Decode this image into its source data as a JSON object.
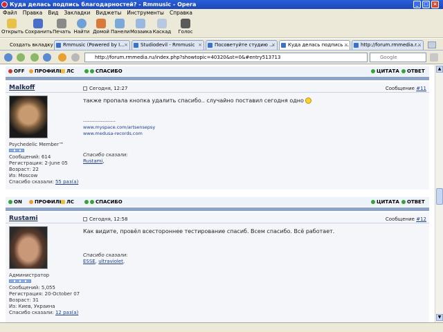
{
  "window": {
    "title": "Куда делась подпись благодарностей? - Rmmusic - Opera"
  },
  "menu": [
    "Файл",
    "Правка",
    "Вид",
    "Закладки",
    "Виджеты",
    "Инструменты",
    "Справка"
  ],
  "toolbar": {
    "buttons": [
      {
        "label": "Открыть",
        "icon": "folder-icon"
      },
      {
        "label": "Сохранить",
        "icon": "save-icon"
      },
      {
        "label": "Печать",
        "icon": "printer-icon"
      },
      {
        "label": "Найти",
        "icon": "magnifier-icon"
      },
      {
        "label": "Домой",
        "icon": "home-icon"
      },
      {
        "label": "Панели",
        "icon": "panels-icon"
      },
      {
        "label": "Мозаика",
        "icon": "tile-icon"
      },
      {
        "label": "Каскад",
        "icon": "cascade-icon"
      },
      {
        "label": "Голос",
        "icon": "voice-icon"
      }
    ]
  },
  "tabs": {
    "new_tab": "Создать вкладку",
    "items": [
      {
        "label": "Rmmusic (Powered by I..."
      },
      {
        "label": "Studiodevil - Rmmusic"
      },
      {
        "label": "Посоветуйте студию ..."
      },
      {
        "label": "Куда делась подпись ..."
      },
      {
        "label": "http://forum.rmmedia.r..."
      }
    ]
  },
  "address": {
    "url": "http://forum.rmmedia.ru/index.php?showtopic=40320&st=0&#entry513713",
    "search_placeholder": "Google"
  },
  "actions": {
    "off": "OFF",
    "on": "ON",
    "profile": "ПРОФИЛЬ",
    "pm": "ЛС",
    "thanks": "СПАСИБО",
    "quote": "ЦИТАТА",
    "reply": "ОТВЕТ"
  },
  "posts": [
    {
      "author": "Malkoff",
      "date": "Сегодня, 12:27",
      "msg_label": "Сообщение ",
      "msg_num": "#11",
      "title": "Psychedelic Member™",
      "posts_count": "Сообщений: 614",
      "registered": "Регистрация: 2-June 05",
      "age": "Возраст: 22",
      "from": "Из: Moscow",
      "thanks_said_label": "Спасибо сказали: ",
      "thanks_said_value": "55 раз(а)",
      "text": "также пропала кнопка удалить спасибо.. случайно поставил сегодня одно",
      "sig_line": "--------------------",
      "sig_links": [
        "www.myspace.com/artsensepsy",
        "www.medusa-records.com"
      ],
      "thx_label": "Спасибо сказали:",
      "thx_users": [
        "Rustami"
      ]
    },
    {
      "author": "Rustami",
      "date": "Сегодня, 12:58",
      "msg_label": "Сообщение ",
      "msg_num": "#12",
      "title": "Администратор",
      "posts_count": "Сообщений: 5,055",
      "registered": "Регистрация: 20-October 07",
      "age": "Возраст: 31",
      "from": "Из: Киев, Украина",
      "thanks_said_label": "Спасибо сказали: ",
      "thanks_said_value": "12 раз(а)",
      "text": "Как видите, провёл всестороннее тестирование спасиб. Всем спасибо. Всё работает.",
      "thx_label": "Спасибо сказали:",
      "thx_users": [
        "ESSE",
        "ultraviolet"
      ]
    }
  ],
  "colors": {
    "titlebar": "#2a5fd8",
    "post_bg": "#f4f6fa",
    "separator": "#8ea3c8",
    "link": "#1c3e8c"
  }
}
